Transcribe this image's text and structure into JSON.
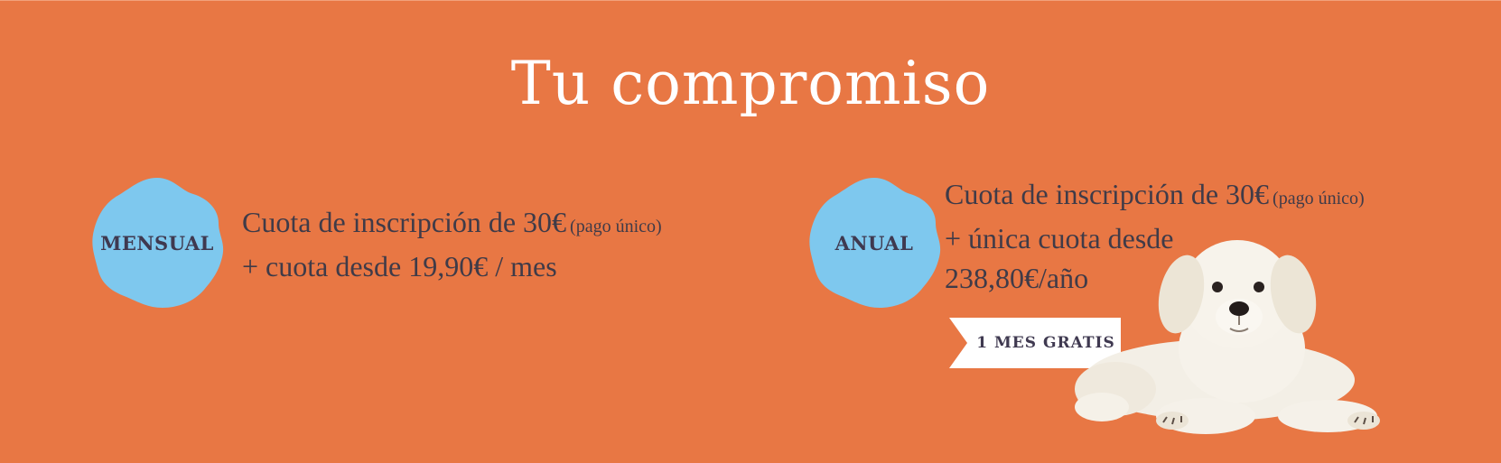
{
  "banner": {
    "title": "Tu compromiso",
    "background_color": "#e87744",
    "badge_color": "#7ec8ee",
    "text_color": "#3f3b48"
  },
  "plans": {
    "monthly": {
      "badge_label": "MENSUAL",
      "line1": "Cuota de inscripción de 30€",
      "line1_note": "(pago único)",
      "line2": "+ cuota desde 19,90€ / mes"
    },
    "annual": {
      "badge_label": "ANUAL",
      "line1": "Cuota de inscripción de 30€",
      "line1_note": "(pago único)",
      "line2": "+ única cuota desde",
      "line3": "238,80€/año",
      "promo_label": "1 MES GRATIS"
    }
  },
  "illustration": {
    "icon": "puppy-image"
  }
}
